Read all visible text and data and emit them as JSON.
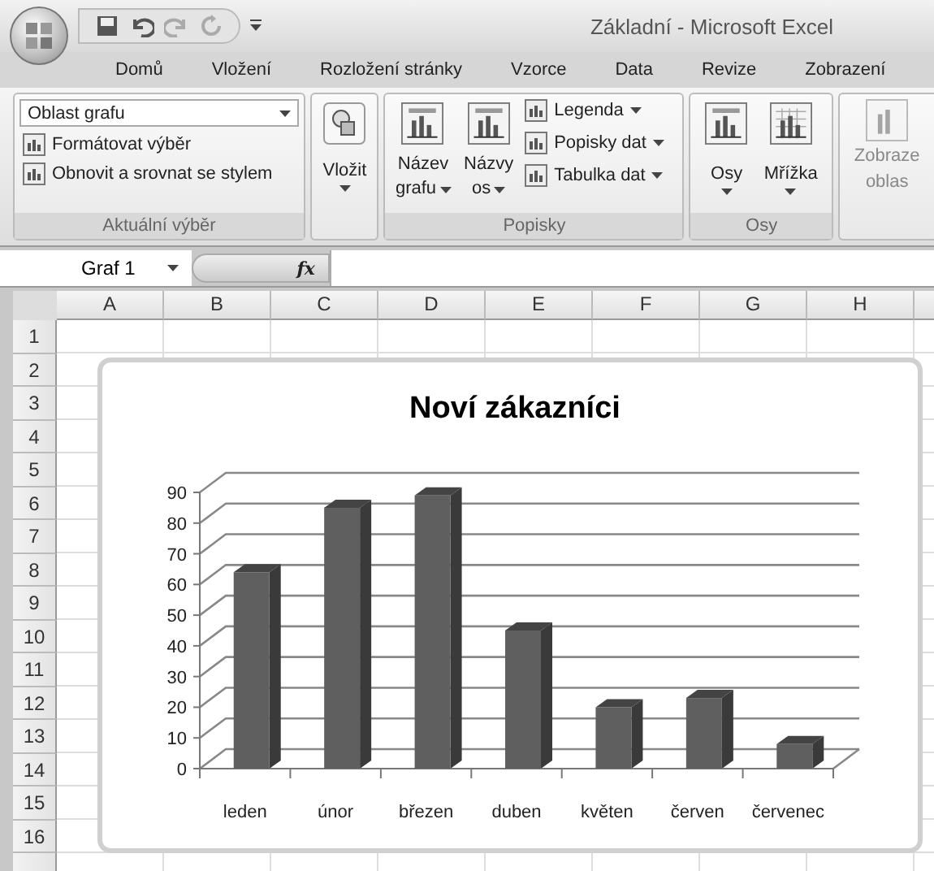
{
  "title_bar": {
    "title": "Základní - Microsoft Excel"
  },
  "ribbon_tabs": [
    {
      "label": "Domů"
    },
    {
      "label": "Vložení"
    },
    {
      "label": "Rozložení stránky"
    },
    {
      "label": "Vzorce"
    },
    {
      "label": "Data"
    },
    {
      "label": "Revize"
    },
    {
      "label": "Zobrazení"
    }
  ],
  "ribbon": {
    "current_selection": {
      "dropdown": "Oblast grafu",
      "items": [
        "Formátovat výběr",
        "Obnovit a srovnat se stylem"
      ],
      "label": "Aktuální výběr"
    },
    "insert": {
      "button": "Vložit"
    },
    "labels_group": {
      "large_buttons": [
        {
          "lines": [
            "Název",
            "grafu"
          ]
        },
        {
          "lines": [
            "Názvy",
            "os"
          ]
        }
      ],
      "small_buttons": [
        "Legenda",
        "Popisky dat",
        "Tabulka dat"
      ],
      "label": "Popisky"
    },
    "axes_group": {
      "buttons": [
        "Osy",
        "Mřížka"
      ],
      "label": "Osy"
    },
    "partial_group": {
      "lines": [
        "Zobraze",
        "oblas"
      ]
    }
  },
  "formula_bar": {
    "name_box": "Graf 1",
    "fx": "fx"
  },
  "sheet": {
    "columns": [
      "A",
      "B",
      "C",
      "D",
      "E",
      "F",
      "G",
      "H"
    ],
    "rows": [
      "1",
      "2",
      "3",
      "4",
      "5",
      "6",
      "7",
      "8",
      "9",
      "10",
      "11",
      "12",
      "13",
      "14",
      "15",
      "16"
    ]
  },
  "chart": {
    "chart_data": {
      "type": "bar",
      "title": "Noví zákazníci",
      "categories": [
        "leden",
        "únor",
        "březen",
        "duben",
        "květen",
        "červen",
        "červenec"
      ],
      "values": [
        64,
        85,
        89,
        45,
        20,
        23,
        8
      ],
      "ylim": [
        0,
        90
      ],
      "yticks": [
        0,
        10,
        20,
        30,
        40,
        50,
        60,
        70,
        80,
        90
      ]
    }
  }
}
